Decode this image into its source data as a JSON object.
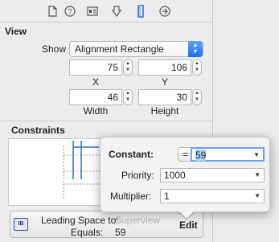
{
  "toolbar": {
    "icons": [
      "file-icon",
      "help-icon",
      "identity-icon",
      "attributes-icon",
      "size-icon",
      "connections-icon"
    ]
  },
  "view": {
    "title": "View",
    "show_label": "Show",
    "show_value": "Alignment Rectangle",
    "x": "75",
    "y": "106",
    "x_label": "X",
    "y_label": "Y",
    "width": "46",
    "height": "30",
    "width_label": "Width",
    "height_label": "Height"
  },
  "constraints": {
    "title": "Constraints",
    "item": {
      "label": "Leading Space to:",
      "target": "Superview",
      "equals_label": "Equals:",
      "equals_value": "59",
      "edit_label": "Edit"
    }
  },
  "popover": {
    "constant_label": "Constant:",
    "relation": "=",
    "constant_value": "59",
    "priority_label": "Priority:",
    "priority_value": "1000",
    "multiplier_label": "Multiplier:",
    "multiplier_value": "1"
  },
  "colors": {
    "accent": "#1f6ff0",
    "selected_icon": "#2a6fe0"
  }
}
